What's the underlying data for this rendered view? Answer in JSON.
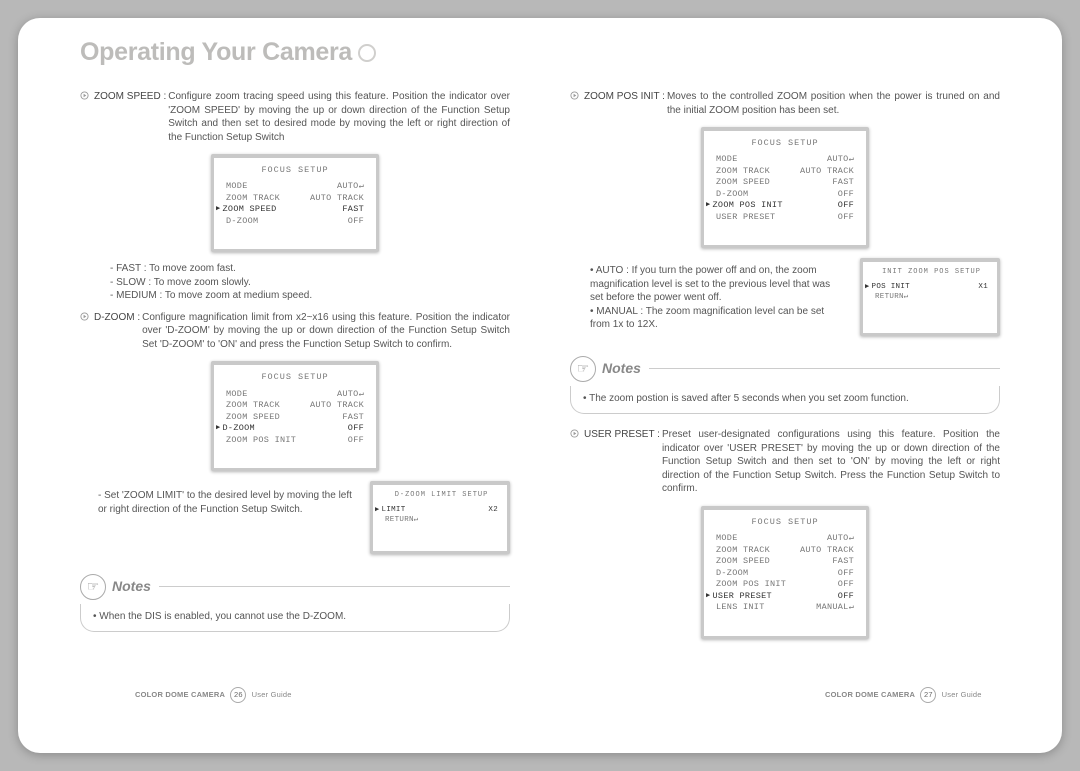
{
  "title": "Operating Your Camera",
  "left": {
    "zoom_speed_label": "ZOOM SPEED : ",
    "zoom_speed_desc": "Configure zoom tracing speed using this feature. Position the indicator over 'ZOOM SPEED' by moving the up or down direction of the Function Setup Switch and then set to desired mode by moving the left or right direction of the Function Setup Switch",
    "zoom_speed_sub": [
      "FAST : To move zoom fast.",
      "SLOW : To move zoom slowly.",
      "MEDIUM : To move zoom at medium speed."
    ],
    "dzoom_label": "D-ZOOM : ",
    "dzoom_desc": "Configure magnification limit from x2~x16 using this feature. Position the indicator over 'D-ZOOM' by moving the up or down direction of the Function Setup Switch Set 'D-ZOOM' to 'ON' and press the Function Setup Switch to confirm.",
    "dzoom_sub": "Set 'ZOOM LIMIT' to the desired level by moving the left or right direction of the Function Setup Switch.",
    "note1": "When the DIS is enabled, you cannot use the D-ZOOM."
  },
  "right": {
    "zpi_label": "ZOOM POS INIT : ",
    "zpi_desc": "Moves to the controlled ZOOM position when the power is truned on and the initial ZOOM position has been set.",
    "zpi_bullets": [
      "AUTO : If you turn the power off and on, the zoom magnification level is set to the previous level that was set before the power went off.",
      "MANUAL : The zoom magnification level can be set from 1x to 12X."
    ],
    "note2": "The zoom postion is saved after 5 seconds when you set zoom function.",
    "up_label": "USER PRESET : ",
    "up_desc": "Preset user-designated configurations using this feature. Position the indicator over 'USER PRESET' by moving the up or down direction of the Function Setup Switch and then set to 'ON' by moving the left or right direction of the Function Setup Switch. Press the Function Setup Switch to confirm."
  },
  "osd": {
    "header": "FOCUS SETUP",
    "mini1_header": "D-ZOOM LIMIT SETUP",
    "mini2_header": "INIT ZOOM POS SETUP",
    "rows_a": [
      {
        "k": "MODE",
        "v": "AUTO↵"
      },
      {
        "k": "ZOOM TRACK",
        "v": "AUTO TRACK"
      },
      {
        "k": "ZOOM SPEED",
        "v": "FAST",
        "sel": true
      },
      {
        "k": "D-ZOOM",
        "v": "OFF"
      }
    ],
    "rows_b": [
      {
        "k": "MODE",
        "v": "AUTO↵"
      },
      {
        "k": "ZOOM TRACK",
        "v": "AUTO TRACK"
      },
      {
        "k": "ZOOM SPEED",
        "v": "FAST"
      },
      {
        "k": "D-ZOOM",
        "v": "OFF",
        "sel": true
      },
      {
        "k": "ZOOM POS INIT",
        "v": "OFF"
      }
    ],
    "rows_c": [
      {
        "k": "MODE",
        "v": "AUTO↵"
      },
      {
        "k": "ZOOM TRACK",
        "v": "AUTO TRACK"
      },
      {
        "k": "ZOOM SPEED",
        "v": "FAST"
      },
      {
        "k": "D-ZOOM",
        "v": "OFF"
      },
      {
        "k": "ZOOM POS INIT",
        "v": "OFF",
        "sel": true
      },
      {
        "k": "USER PRESET",
        "v": "OFF"
      }
    ],
    "rows_d": [
      {
        "k": "MODE",
        "v": "AUTO↵"
      },
      {
        "k": "ZOOM TRACK",
        "v": "AUTO TRACK"
      },
      {
        "k": "ZOOM SPEED",
        "v": "FAST"
      },
      {
        "k": "D-ZOOM",
        "v": "OFF"
      },
      {
        "k": "ZOOM POS INIT",
        "v": "OFF"
      },
      {
        "k": "USER PRESET",
        "v": "OFF",
        "sel": true
      },
      {
        "k": "LENS INIT",
        "v": "MANUAL↵"
      }
    ],
    "mini1_rows": [
      {
        "k": "LIMIT",
        "v": "X2",
        "sel": true
      },
      {
        "k": "RETURN↵",
        "v": ""
      }
    ],
    "mini2_rows": [
      {
        "k": "POS INIT",
        "v": "X1",
        "sel": true
      },
      {
        "k": "RETURN↵",
        "v": ""
      }
    ]
  },
  "notes_title": "Notes",
  "footer": {
    "prod": "COLOR DOME CAMERA",
    "ug": "User Guide",
    "p_left": "26",
    "p_right": "27"
  }
}
